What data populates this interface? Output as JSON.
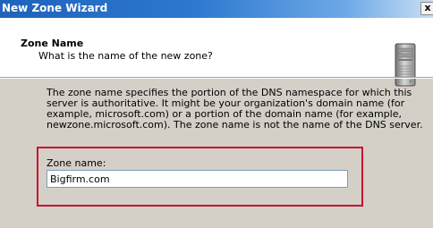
{
  "window": {
    "title": "New Zone Wizard",
    "close_label": "x"
  },
  "header": {
    "title": "Zone Name",
    "subtitle": "What is the name of the new zone?",
    "icon": "server-icon"
  },
  "body": {
    "description": "The zone name specifies the portion of the DNS namespace for which this server is authoritative. It might be your organization's domain name (for example,  microsoft.com) or a portion of the domain name (for example, newzone.microsoft.com). The zone name is not the name of the DNS server.",
    "zone_name_label": "Zone name:",
    "zone_name_value": "Bigfirm.com"
  },
  "colors": {
    "titlebar": "#2d78d0",
    "highlight_box": "#c8102e",
    "dialog_bg": "#d4d0c8"
  }
}
